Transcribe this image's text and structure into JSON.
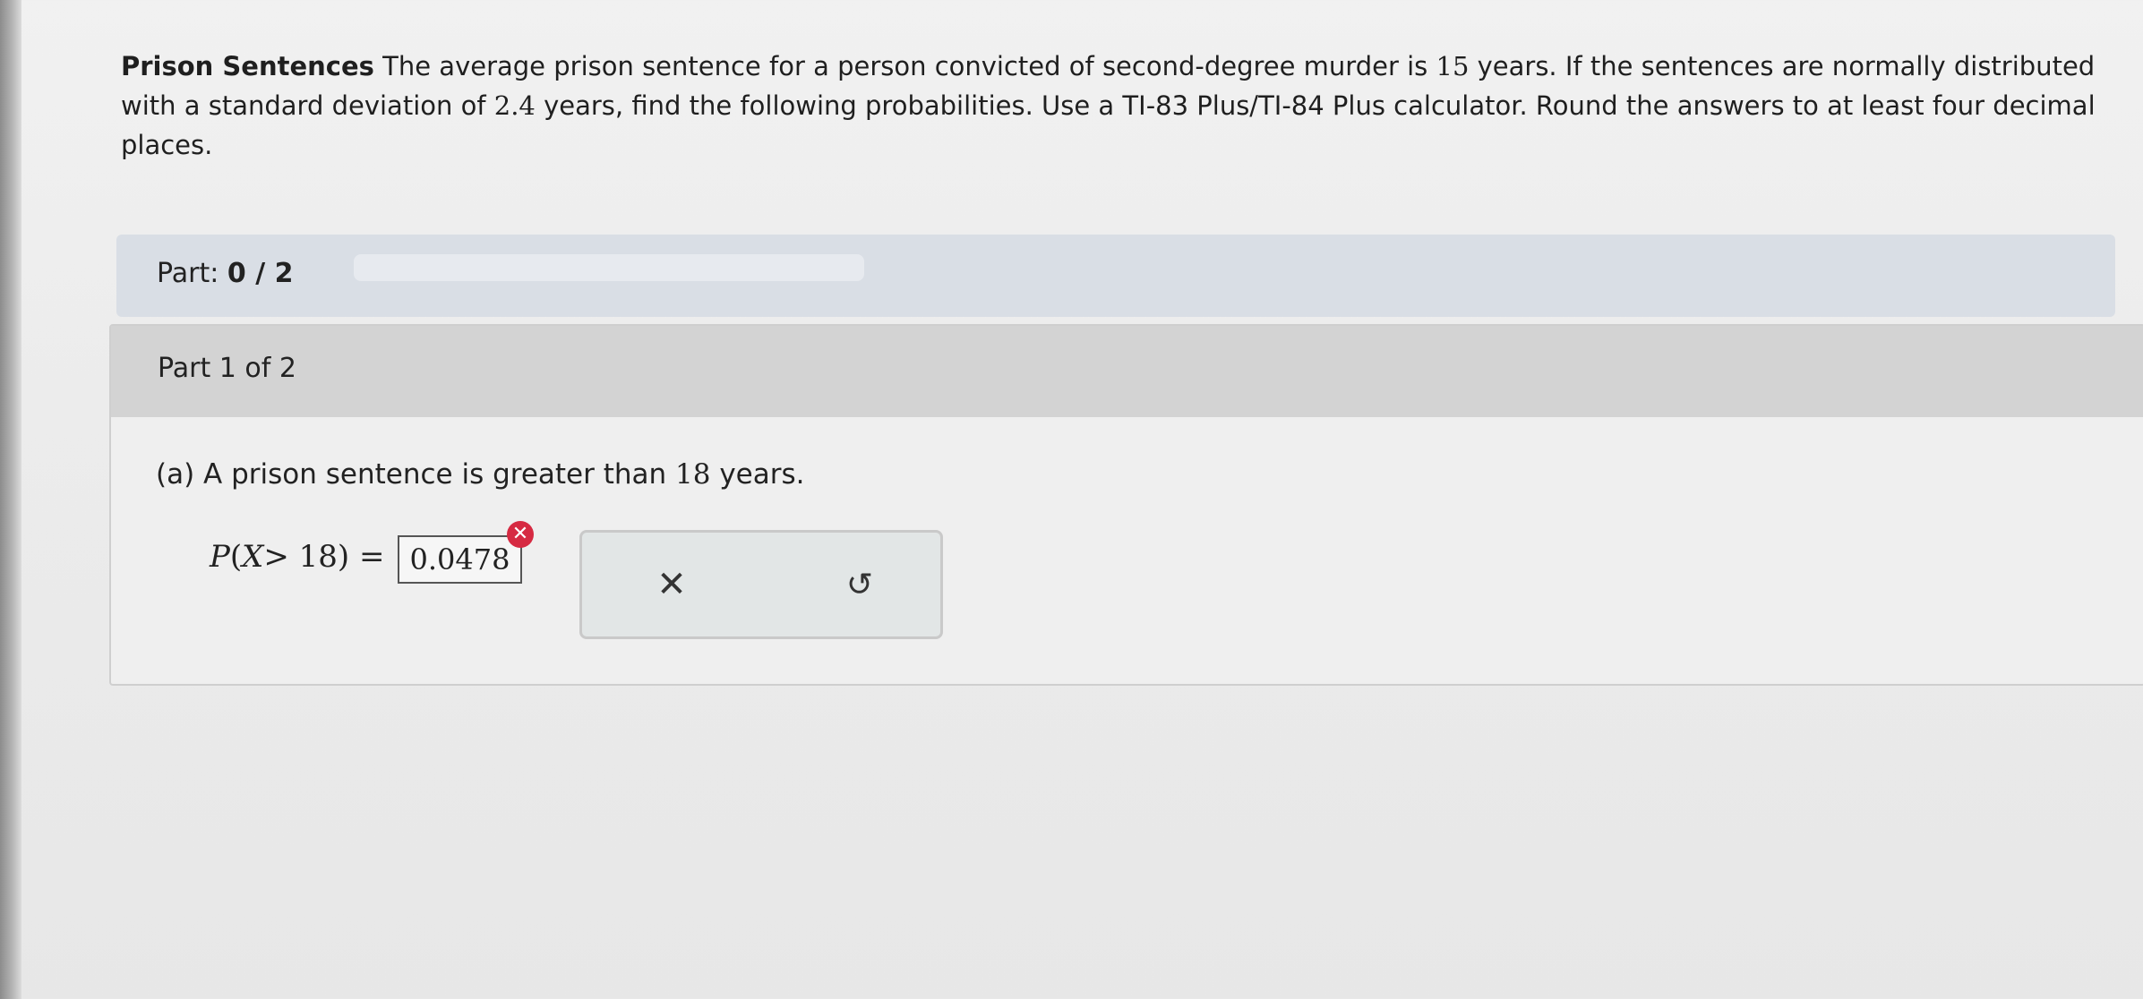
{
  "problem": {
    "title": "Prison Sentences",
    "text_1": " The average prison sentence for a person convicted of second-degree murder is ",
    "mean": "15",
    "text_2": " years. If the sentences are normally distributed with a standard deviation of ",
    "sd": "2.4",
    "text_3": " years, find the following probabilities. Use a TI-83 Plus/TI-84 Plus calculator. Round the answers to at least four decimal places."
  },
  "progress": {
    "label": "Part:",
    "completed": "0",
    "separator": " / ",
    "total": "2",
    "fraction": 0
  },
  "part": {
    "header": "Part 1 of 2",
    "question_prefix": "(a) A prison sentence is greater than ",
    "question_value": "18",
    "question_suffix": " years.",
    "equation_p": "P",
    "equation_open": "(",
    "equation_var": "X",
    "equation_rest": "> 18) =",
    "answer_value": "0.0478"
  },
  "icons": {
    "error": "error-x-icon",
    "clear": "x-icon",
    "reset": "undo-icon"
  },
  "colors": {
    "error": "#d62a42",
    "part_bar": "#d9dee5",
    "header": "#d3d3d3"
  }
}
